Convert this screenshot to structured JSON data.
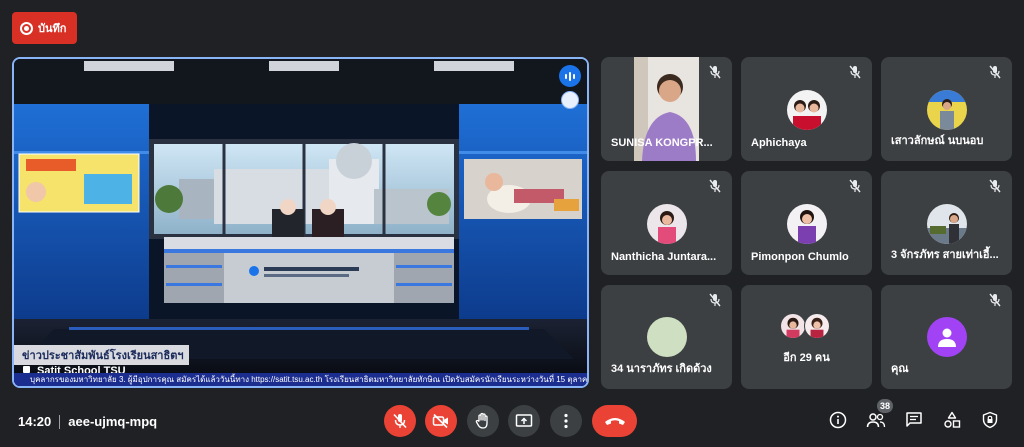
{
  "recording": {
    "label": "บันทึก"
  },
  "presenter": {
    "name": "Satit School TSU",
    "lower_third": "ข่าวประชาสัมพันธ์โรงเรียนสาธิตฯ",
    "ticker": "บุคลากรของมหาวิทยาลัย 3. ผู้มีอุปการคุณ สมัครได้แล้ววันนี้ทาง https://satit.tsu.ac.th โรงเรียนสาธิตมหาวิทยาลัยทักษิณ เปิดรับสมัครนักเรียนระหว่างวันที่ 15 ตุลาคม - 15 ธันวาคม 25"
  },
  "participants": [
    {
      "name": "SUNISA KONGPR..."
    },
    {
      "name": "Aphichaya"
    },
    {
      "name": "เสาวลักษณ์ นบนอบ"
    },
    {
      "name": "Nanthicha Juntara..."
    },
    {
      "name": "Pimonpon Chumlo"
    },
    {
      "name": "3 จักรภัทร สายเท่าเอี้..."
    },
    {
      "name": "34 นาราภัทร เกิดด้วง"
    },
    {
      "name": "อีก 29 คน"
    },
    {
      "name": "คุณ"
    }
  ],
  "meeting": {
    "time": "14:20",
    "code": "aee-ujmq-mpq"
  },
  "people_count": "38",
  "colors": {
    "accent": "#8ab4f8",
    "danger": "#ea4335",
    "surface": "#3c4043",
    "background": "#202124"
  }
}
